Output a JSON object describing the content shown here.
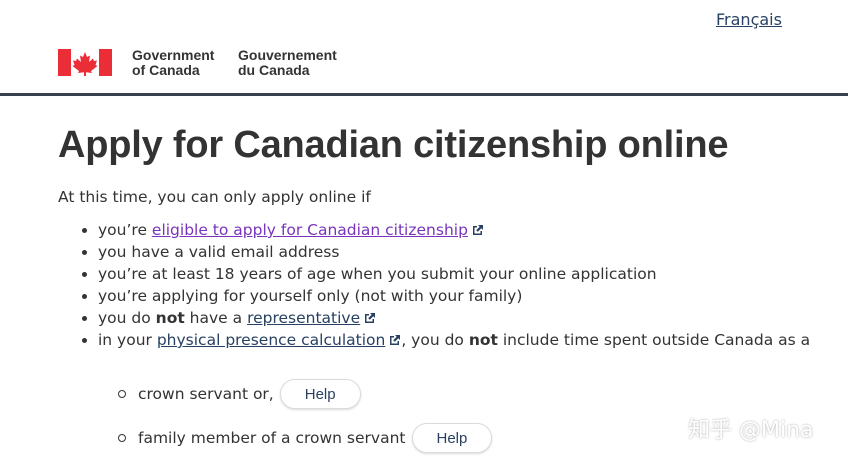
{
  "header": {
    "language_link": "Français",
    "signature_en": [
      "Government",
      "of Canada"
    ],
    "signature_fr": [
      "Gouvernement",
      "du Canada"
    ]
  },
  "main": {
    "title": "Apply for Canadian citizenship online",
    "intro": "At this time, you can only apply online if",
    "items": [
      {
        "prefix": "you’re ",
        "link": "eligible to apply for Canadian citizenship"
      },
      {
        "text": "you have a valid email address"
      },
      {
        "text": "you’re at least 18 years of age when you submit your online application"
      },
      {
        "text": "you’re applying for yourself only (not with your family)"
      },
      {
        "prefix": "you do ",
        "bold": "not",
        "middle": " have a ",
        "link": "representative"
      },
      {
        "prefix": "in your ",
        "link": "physical presence calculation",
        "after": ", you do ",
        "bold": "not",
        "suffix": " include time spent outside Canada as a"
      }
    ],
    "sub_items": [
      {
        "text": "crown servant or,",
        "button": "Help"
      },
      {
        "text": "family member of a crown servant",
        "button": "Help"
      }
    ]
  },
  "watermark": "知乎 @Mina",
  "colors": {
    "link": "#284162",
    "visited_link": "#7834bc",
    "flag_red": "#eb2d37",
    "rule": "#38414d"
  }
}
